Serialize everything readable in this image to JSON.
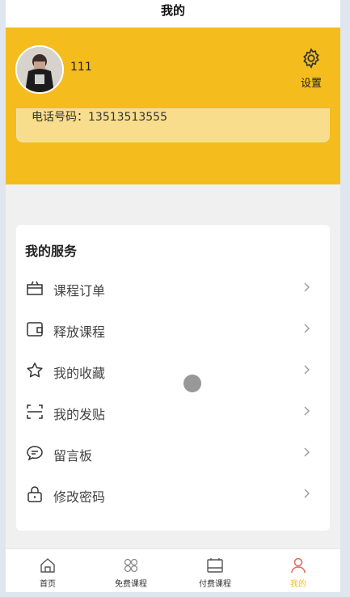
{
  "page": {
    "title": "我的"
  },
  "profile": {
    "username": "111",
    "settings_label": "设置",
    "phone_text": "电话号码：13513513555"
  },
  "services": {
    "title": "我的服务",
    "items": [
      {
        "label": "课程订单",
        "icon": "gift-icon"
      },
      {
        "label": "释放课程",
        "icon": "wallet-icon"
      },
      {
        "label": "我的收藏",
        "icon": "star-icon"
      },
      {
        "label": "我的发贴",
        "icon": "scan-icon"
      },
      {
        "label": "留言板",
        "icon": "message-icon"
      },
      {
        "label": "修改密码",
        "icon": "lock-icon"
      }
    ]
  },
  "tabbar": {
    "items": [
      {
        "label": "首页",
        "icon": "home-icon"
      },
      {
        "label": "免费课程",
        "icon": "grid-icon"
      },
      {
        "label": "付费课程",
        "icon": "calendar-icon"
      },
      {
        "label": "我的",
        "icon": "user-icon",
        "active": true
      }
    ]
  },
  "colors": {
    "accent": "#f4bd1d",
    "card": "#f8dd8c",
    "background": "#f0f0f0"
  }
}
